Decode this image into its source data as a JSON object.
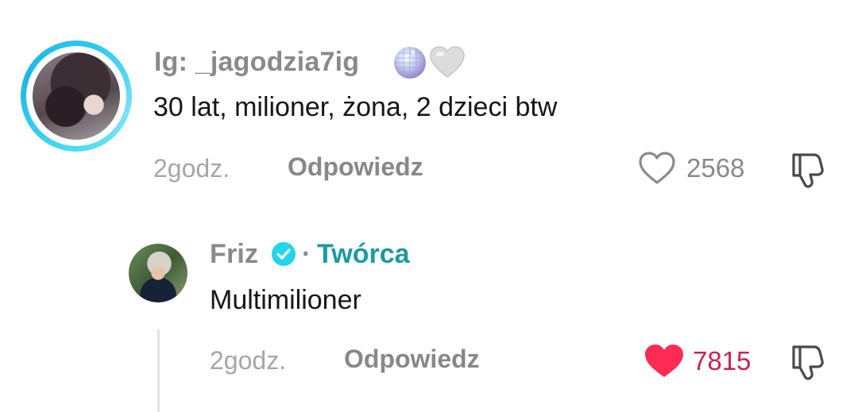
{
  "comments": [
    {
      "username": "Ig: _jagodzia7ig",
      "username_emojis": [
        "mirror-ball",
        "white-heart"
      ],
      "text": "30 lat, milioner, żona, 2 dzieci btw",
      "time": "2godz.",
      "reply_label": "Odpowiedz",
      "likes": "2568",
      "liked": false,
      "ring_color": "#2fc4ee"
    }
  ],
  "reply": {
    "username": "Friz",
    "verified": true,
    "separator": "·",
    "badge_label": "Twórca",
    "badge_color": "#1b9aa3",
    "text": "Multimilioner",
    "time": "2godz.",
    "reply_label": "Odpowiedz",
    "likes": "7815",
    "liked": true,
    "like_color": "#fe2c55"
  },
  "icons": {
    "heart_outline": "heart-outline-icon",
    "heart_filled": "heart-filled-icon",
    "dislike": "thumbs-down-icon",
    "verified": "verified-badge-icon"
  }
}
